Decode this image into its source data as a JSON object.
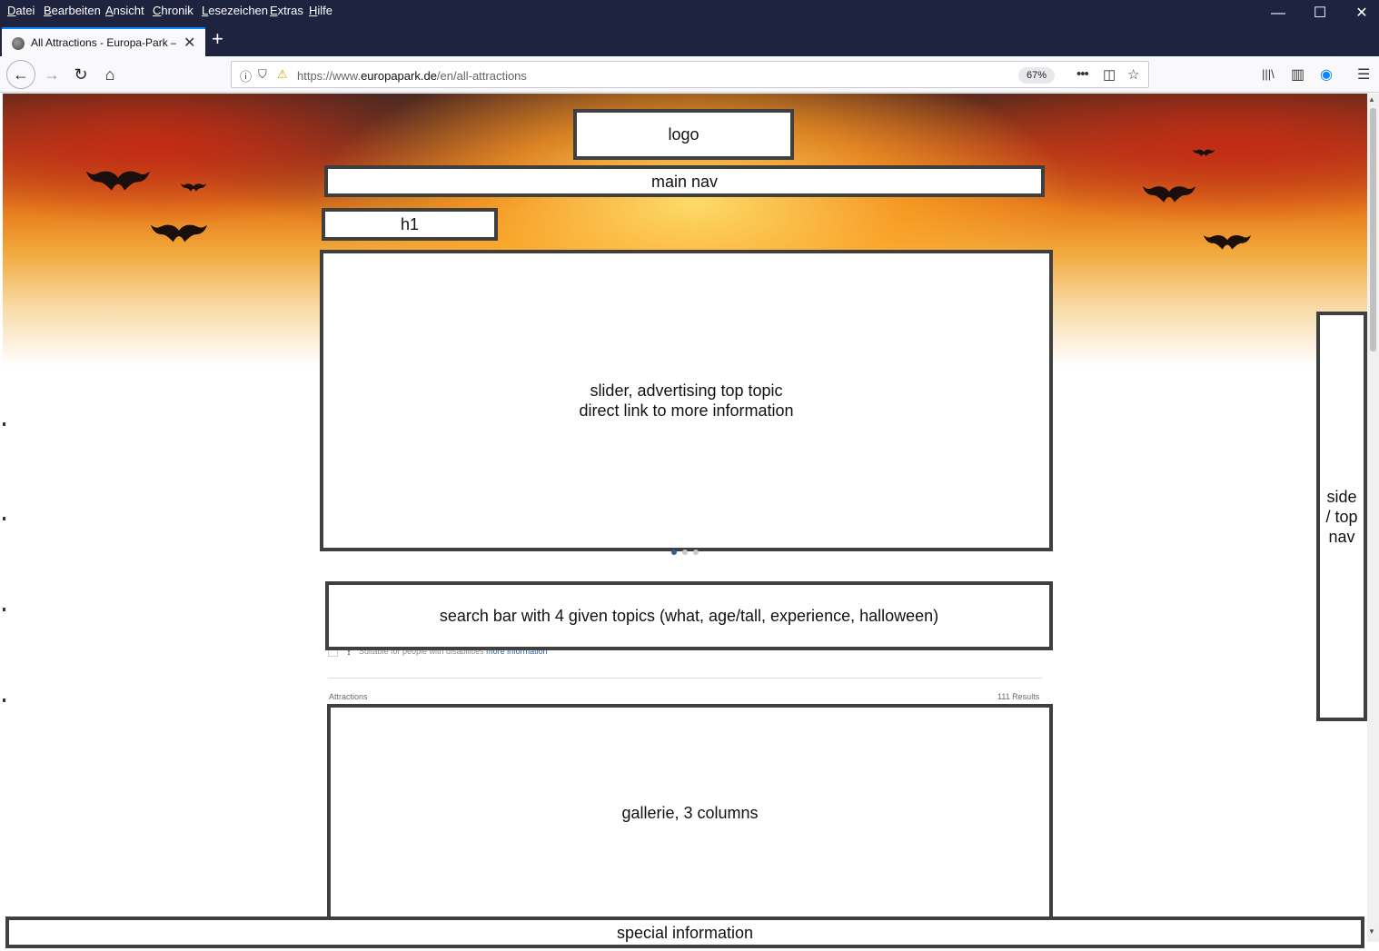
{
  "browser": {
    "menu": [
      "Datei",
      "Bearbeiten",
      "Ansicht",
      "Chronik",
      "Lesezeichen",
      "Extras",
      "Hilfe"
    ],
    "window_controls": {
      "minimize": "—",
      "maximize": "☐",
      "close": "✕"
    },
    "tab": {
      "title": "All Attractions - Europa-Park –",
      "close": "✕"
    },
    "new_tab": "+",
    "url": {
      "prefix": "https://www.",
      "domain": "europapark.de",
      "path": "/en/all-attractions"
    },
    "zoom": "67%",
    "icons": {
      "back": "←",
      "forward": "→",
      "reload": "↻",
      "home": "⌂",
      "info": "ⓘ",
      "shield": "⛉",
      "lock_warning": "⚠",
      "more": "•••",
      "pocket": "◫",
      "bookmark": "☆",
      "library": "|||\\",
      "sidebar": "▥",
      "account": "◉",
      "menu": "☰"
    },
    "icon_names": [
      "back-icon",
      "forward-icon",
      "reload-icon",
      "home-icon",
      "info-icon",
      "shield-icon",
      "lock-warning-icon",
      "more-icon",
      "pocket-icon",
      "bookmark-star-icon",
      "library-icon",
      "sidebar-icon",
      "account-icon",
      "hamburger-menu-icon"
    ]
  },
  "wireframe": {
    "logo": "logo",
    "main_nav": "main nav",
    "h1": "h1",
    "slider": [
      "slider, advertising top topic",
      "direct link to more information"
    ],
    "search_bar": "search bar with 4 given topics (what, age/tall, experience, halloween)",
    "gallery": "gallerie, 3 columns",
    "side_nav": [
      "side",
      "/ top",
      "nav"
    ],
    "special_info": "special information"
  },
  "page": {
    "accessibility_filter": {
      "text": "Suitable for people with disabilities",
      "link": "more information"
    },
    "results_label": "Attractions",
    "results_count": "111 Results",
    "slider_dots": 3,
    "slider_active_dot": 1,
    "colors": {
      "accent": "#2f5e9c",
      "frame": "#3f3f3f",
      "chrome": "#1e2340"
    }
  }
}
